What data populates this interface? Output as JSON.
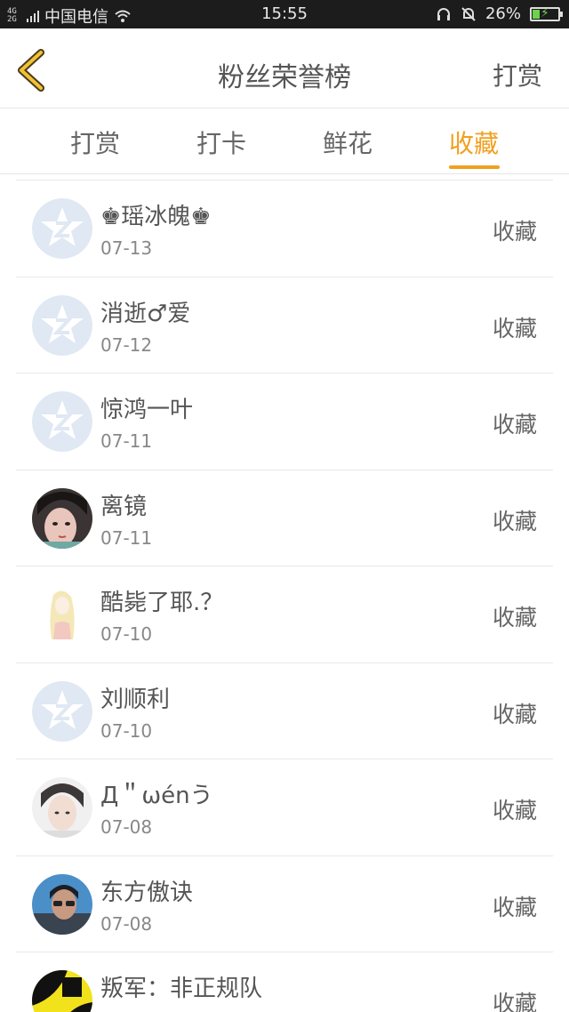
{
  "status_bar": {
    "network": "4G 2G",
    "carrier": "中国电信",
    "time": "15:55",
    "battery": "26%"
  },
  "header": {
    "title": "粉丝荣誉榜",
    "action": "打赏"
  },
  "tabs": [
    {
      "label": "打赏",
      "active": false
    },
    {
      "label": "打卡",
      "active": false
    },
    {
      "label": "鲜花",
      "active": false
    },
    {
      "label": "收藏",
      "active": true
    }
  ],
  "rows": [
    {
      "name": "♚瑶冰魄♚",
      "date": "07-13",
      "action": "收藏",
      "avatar": "default-avatar"
    },
    {
      "name": "消逝♂爱",
      "date": "07-12",
      "action": "收藏",
      "avatar": "default-avatar"
    },
    {
      "name": "惊鸿一叶",
      "date": "07-11",
      "action": "收藏",
      "avatar": "default-avatar"
    },
    {
      "name": "离镜",
      "date": "07-11",
      "action": "收藏",
      "avatar": "photo-avatar"
    },
    {
      "name": "酷毙了耶.？",
      "date": "07-10",
      "action": "收藏",
      "avatar": "drawing-avatar"
    },
    {
      "name": "刘顺利",
      "date": "07-10",
      "action": "收藏",
      "avatar": "default-avatar"
    },
    {
      "name": "Д＂ωénう",
      "date": "07-08",
      "action": "收藏",
      "avatar": "photo-avatar"
    },
    {
      "name": "东方傲诀",
      "date": "07-08",
      "action": "收藏",
      "avatar": "photo-avatar"
    },
    {
      "name": "叛军：非正规队",
      "date": "",
      "action": "收藏",
      "avatar": "photo-avatar"
    }
  ],
  "colors": {
    "accent": "#f0a020",
    "back_arrow": "#f2c230",
    "default_avatar_bg": "#dfe8f3"
  }
}
